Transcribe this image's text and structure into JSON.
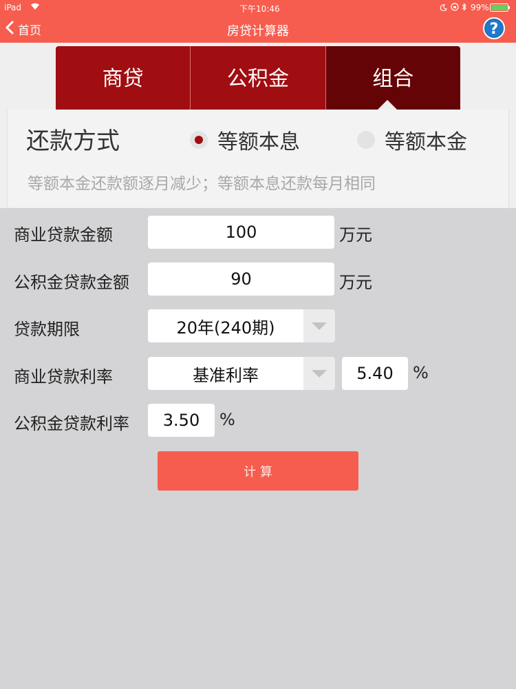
{
  "status_bar": {
    "device": "iPad",
    "time": "下午10:46",
    "battery": "99%"
  },
  "nav": {
    "back_label": "首页",
    "title": "房贷计算器",
    "help_label": "?"
  },
  "tabs": [
    {
      "label": "商贷"
    },
    {
      "label": "公积金"
    },
    {
      "label": "组合",
      "active": true
    }
  ],
  "repayment": {
    "label": "还款方式",
    "options": [
      {
        "label": "等额本息",
        "checked": true
      },
      {
        "label": "等额本金",
        "checked": false
      }
    ],
    "hint": "等额本金还款额逐月减少；等额本息还款每月相同"
  },
  "form": {
    "commercial_amount": {
      "label": "商业贷款金额",
      "value": "100",
      "unit": "万元"
    },
    "fund_amount": {
      "label": "公积金贷款金额",
      "value": "90",
      "unit": "万元"
    },
    "term": {
      "label": "贷款期限",
      "value": "20年(240期)"
    },
    "commercial_rate": {
      "label": "商业贷款利率",
      "type_value": "基准利率",
      "value": "5.40",
      "unit": "%"
    },
    "fund_rate": {
      "label": "公积金贷款利率",
      "value": "3.50",
      "unit": "%"
    }
  },
  "calculate_label": "计 算",
  "colors": {
    "nav_bg": "#f65d4e",
    "tab_bg": "#a00e12",
    "tab_active_bg": "#650406",
    "button_bg": "#f65d4e"
  }
}
